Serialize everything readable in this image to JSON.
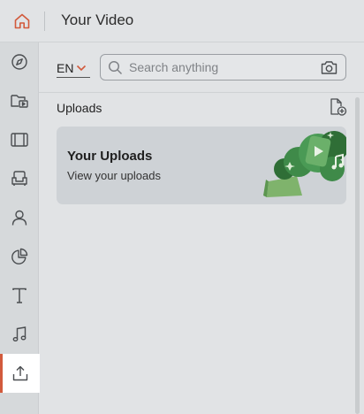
{
  "header": {
    "title": "Your Video",
    "home_icon": "home-icon"
  },
  "sidebar": {
    "items": [
      {
        "name": "discover",
        "icon": "compass-icon",
        "active": false
      },
      {
        "name": "media-library",
        "icon": "folder-video-icon",
        "active": false
      },
      {
        "name": "videos",
        "icon": "film-icon",
        "active": false
      },
      {
        "name": "seating",
        "icon": "armchair-icon",
        "active": false
      },
      {
        "name": "profile",
        "icon": "person-icon",
        "active": false
      },
      {
        "name": "analytics",
        "icon": "pie-chart-icon",
        "active": false
      },
      {
        "name": "text",
        "icon": "text-icon",
        "active": false
      },
      {
        "name": "music",
        "icon": "music-icon",
        "active": false
      },
      {
        "name": "uploads",
        "icon": "upload-icon",
        "active": true
      }
    ]
  },
  "toolbar": {
    "language": "EN",
    "search_placeholder": "Search anything",
    "search_value": ""
  },
  "section": {
    "title": "Uploads"
  },
  "upload_card": {
    "title": "Your Uploads",
    "subtitle": "View your uploads"
  },
  "colors": {
    "accent": "#d25a3c",
    "background": "#e1e3e5",
    "sidebar": "#d6d9db",
    "card": "#ced2d6",
    "illustration_green": "#3f8a49"
  }
}
